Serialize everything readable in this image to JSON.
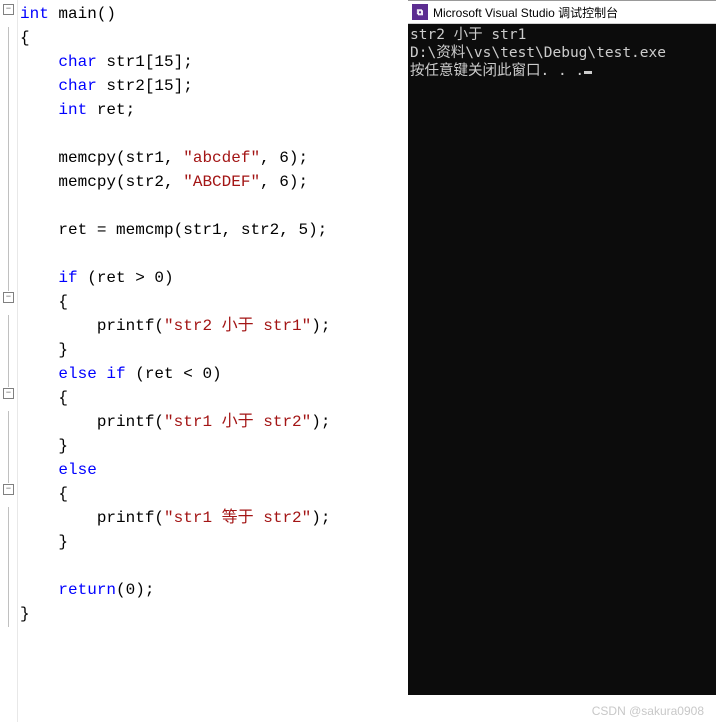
{
  "code": {
    "lines": [
      [
        {
          "cls": "kw",
          "t": "int"
        },
        {
          "cls": "txt",
          "t": " main()"
        }
      ],
      [
        {
          "cls": "txt",
          "t": "{"
        }
      ],
      [
        {
          "cls": "txt",
          "t": "    "
        },
        {
          "cls": "kw",
          "t": "char"
        },
        {
          "cls": "txt",
          "t": " str1["
        },
        {
          "cls": "num",
          "t": "15"
        },
        {
          "cls": "txt",
          "t": "];"
        }
      ],
      [
        {
          "cls": "txt",
          "t": "    "
        },
        {
          "cls": "kw",
          "t": "char"
        },
        {
          "cls": "txt",
          "t": " str2["
        },
        {
          "cls": "num",
          "t": "15"
        },
        {
          "cls": "txt",
          "t": "];"
        }
      ],
      [
        {
          "cls": "txt",
          "t": "    "
        },
        {
          "cls": "kw",
          "t": "int"
        },
        {
          "cls": "txt",
          "t": " ret;"
        }
      ],
      [
        {
          "cls": "txt",
          "t": ""
        }
      ],
      [
        {
          "cls": "txt",
          "t": "    memcpy(str1, "
        },
        {
          "cls": "str",
          "t": "\"abcdef\""
        },
        {
          "cls": "txt",
          "t": ", "
        },
        {
          "cls": "num",
          "t": "6"
        },
        {
          "cls": "txt",
          "t": ");"
        }
      ],
      [
        {
          "cls": "txt",
          "t": "    memcpy(str2, "
        },
        {
          "cls": "str",
          "t": "\"ABCDEF\""
        },
        {
          "cls": "txt",
          "t": ", "
        },
        {
          "cls": "num",
          "t": "6"
        },
        {
          "cls": "txt",
          "t": ");"
        }
      ],
      [
        {
          "cls": "txt",
          "t": ""
        }
      ],
      [
        {
          "cls": "txt",
          "t": "    ret = memcmp(str1, str2, "
        },
        {
          "cls": "num",
          "t": "5"
        },
        {
          "cls": "txt",
          "t": ");"
        }
      ],
      [
        {
          "cls": "txt",
          "t": ""
        }
      ],
      [
        {
          "cls": "txt",
          "t": "    "
        },
        {
          "cls": "kw",
          "t": "if"
        },
        {
          "cls": "txt",
          "t": " (ret > "
        },
        {
          "cls": "num",
          "t": "0"
        },
        {
          "cls": "txt",
          "t": ")"
        }
      ],
      [
        {
          "cls": "txt",
          "t": "    {"
        }
      ],
      [
        {
          "cls": "txt",
          "t": "        printf("
        },
        {
          "cls": "str",
          "t": "\"str2 小于 str1\""
        },
        {
          "cls": "txt",
          "t": ");"
        }
      ],
      [
        {
          "cls": "txt",
          "t": "    }"
        }
      ],
      [
        {
          "cls": "txt",
          "t": "    "
        },
        {
          "cls": "kw",
          "t": "else"
        },
        {
          "cls": "txt",
          "t": " "
        },
        {
          "cls": "kw",
          "t": "if"
        },
        {
          "cls": "txt",
          "t": " (ret < "
        },
        {
          "cls": "num",
          "t": "0"
        },
        {
          "cls": "txt",
          "t": ")"
        }
      ],
      [
        {
          "cls": "txt",
          "t": "    {"
        }
      ],
      [
        {
          "cls": "txt",
          "t": "        printf("
        },
        {
          "cls": "str",
          "t": "\"str1 小于 str2\""
        },
        {
          "cls": "txt",
          "t": ");"
        }
      ],
      [
        {
          "cls": "txt",
          "t": "    }"
        }
      ],
      [
        {
          "cls": "txt",
          "t": "    "
        },
        {
          "cls": "kw",
          "t": "else"
        }
      ],
      [
        {
          "cls": "txt",
          "t": "    {"
        }
      ],
      [
        {
          "cls": "txt",
          "t": "        printf("
        },
        {
          "cls": "str",
          "t": "\"str1 等于 str2\""
        },
        {
          "cls": "txt",
          "t": ");"
        }
      ],
      [
        {
          "cls": "txt",
          "t": "    }"
        }
      ],
      [
        {
          "cls": "txt",
          "t": ""
        }
      ],
      [
        {
          "cls": "txt",
          "t": "    "
        },
        {
          "cls": "kw",
          "t": "return"
        },
        {
          "cls": "txt",
          "t": "("
        },
        {
          "cls": "num",
          "t": "0"
        },
        {
          "cls": "txt",
          "t": ");"
        }
      ],
      [
        {
          "cls": "txt",
          "t": "}"
        }
      ]
    ],
    "fold_marks": [
      0,
      12,
      16,
      20
    ]
  },
  "console": {
    "icon_text": "⧉",
    "title": "Microsoft Visual Studio 调试控制台",
    "lines": [
      "str2 小于 str1",
      "D:\\资料\\vs\\test\\Debug\\test.exe",
      "按任意键关闭此窗口. . ."
    ]
  },
  "watermark": "CSDN @sakura0908"
}
